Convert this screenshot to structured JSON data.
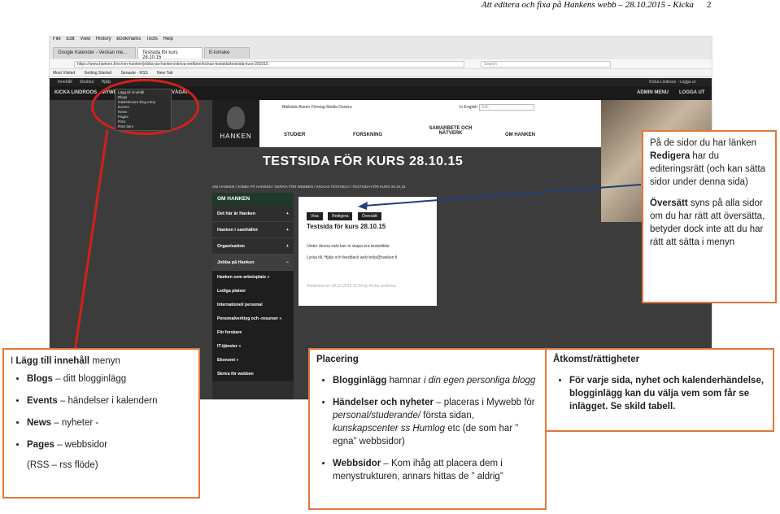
{
  "doc_header": {
    "title": "Att editera och fixa på Hankens webb – 28.10.2015 - Kicka",
    "page_number": "2"
  },
  "browser": {
    "menu": [
      "File",
      "Edit",
      "View",
      "History",
      "Bookmarks",
      "Tools",
      "Help"
    ],
    "tabs": [
      "Google Kalender - Veckan me...",
      "Testsida för kurs 28.10.15",
      "E-lomake"
    ],
    "url": "https://www.hanken.fi/sv/om-hanken/jobba-pa-hanken/skriva-webben/kickas-testsida/testsida-kurs-281015",
    "search_placeholder": "Search",
    "bookmarks": [
      "Most Visited",
      "Getting Started",
      "Senaste - RSS",
      "New Tab"
    ]
  },
  "wp_adminbar": {
    "items": [
      "Innehåll",
      "Struktur",
      "Hjälp"
    ],
    "right": "Kicka Lindroos · Logga ut"
  },
  "site": {
    "topnav": {
      "user": "KICKA LINDROOS",
      "myweb": "MYWEB",
      "vagar": "VÄGAR",
      "admin_menu": "ADMIN MENU",
      "logout": "LOGGA UT"
    },
    "dropdown": [
      "Lägg till innehåll",
      "Blogs",
      "Gästskrivare blog entry",
      "Events",
      "News",
      "Pages",
      "RSS",
      "RSS item"
    ],
    "logo_text": "HANKEN",
    "menu_small": "Bibliotek   Alumn   Företag   Media   Donera",
    "lang": "In English",
    "search": "Sök",
    "menu_main": [
      "STUDIER",
      "FORSKNING",
      "SAMARBETE OCH NÄTVERK",
      "OM HANKEN"
    ],
    "big_title": "TESTSIDA FÖR KURS 28.10.15",
    "breadcrumb": "OM HANKEN / JOBBA PÅ HANKEN / SKRIVA FÖR WEBBEN / KICKAS TESTSIDA! / TESTSIDA FÖR KURS 28.10.15",
    "leftnav_header": "OM HANKEN",
    "leftnav_items": [
      "Det här är Hanken",
      "Hanken i samhället",
      "Organisation",
      "Jobba på Hanken"
    ],
    "leftnav_sub": [
      "Hanken som arbetsplats »",
      "Lediga platser",
      "Internationell personal",
      "Personalverktyg och -resurser »",
      "För forskare",
      "IT-tjänster »",
      "Ekonomi »",
      "Skriva för webben"
    ],
    "content": {
      "buttons": [
        "Visa",
        "Redigera",
        "Översätt"
      ],
      "heading": "Testsida för kurs 28.10.15",
      "line1": "Under denna sida kan ni skapa era testartiklar",
      "line2": "Lycka till. Hjälp och feedback web-help@hanken.fi",
      "published": "Published on 28.10.2015 11:50 by Kicka Lindroos"
    }
  },
  "callouts": {
    "right": {
      "p1_a": "På de sidor du har länken ",
      "p1_b": "Redigera",
      "p1_c": " har du editeringsrätt (och kan sätta sidor under denna sida)",
      "p2_a": "Översätt",
      "p2_b": " syns på alla sidor om du har rätt att översätta, betyder dock inte att du har rätt att sätta i menyn"
    },
    "left": {
      "title_a": "I ",
      "title_b": "Lägg till innehåll",
      "title_c": " menyn",
      "items": [
        {
          "term": "Blogs",
          "desc": " – ditt blogginlägg"
        },
        {
          "term": "Events",
          "desc": " – händelser i kalendern"
        },
        {
          "term": "News",
          "desc": " – nyheter -"
        },
        {
          "term": "Pages",
          "desc": " – webbsidor"
        }
      ],
      "rss": "(RSS – rss flöde)"
    },
    "mid": {
      "title": "Placering",
      "i1_a": "Blogginlägg",
      "i1_b": " hamnar ",
      "i1_c": "i din egen personliga blogg",
      "i2_a": "Händelser och nyheter",
      "i2_b": " – placeras i Mywebb för ",
      "i2_c": "personal/studerande/",
      "i2_d": " första sidan, ",
      "i2_e": "kunskapscenter ss Humlog",
      "i2_f": " etc (de som har ” egna” webbsidor)",
      "i3_a": "Webbsidor",
      "i3_b": " – Kom ihåg att placera dem i menystrukturen, annars hittas de ” aldrig”"
    },
    "access": {
      "title": "Åtkomst/rättigheter",
      "item": "För varje sida, nyhet och kalenderhändelse, blogginlägg kan du välja vem som får se inlägget. Se skild tabell."
    }
  },
  "colors": {
    "callout_border": "#e0783a",
    "annotation_red": "#d4201a"
  }
}
